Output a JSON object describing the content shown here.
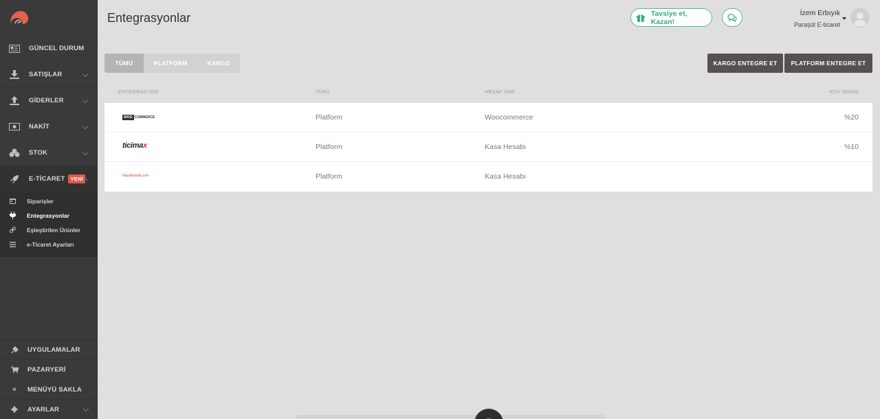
{
  "header": {
    "title": "Entegrasyonlar",
    "refer_label": "Tavsiye et, Kazan!",
    "user_name": "İzem Erbıyık",
    "company": "Paraşüt E-ticaret"
  },
  "sidebar": {
    "items": [
      {
        "label": "GÜNCEL DURUM",
        "icon": "newspaper-icon"
      },
      {
        "label": "SATIŞLAR",
        "icon": "download-icon"
      },
      {
        "label": "GİDERLER",
        "icon": "upload-icon"
      },
      {
        "label": "NAKİT",
        "icon": "cash-icon"
      },
      {
        "label": "STOK",
        "icon": "cubes-icon"
      },
      {
        "label": "E-TİCARET",
        "icon": "rocket-icon",
        "badge": "YENİ"
      }
    ],
    "sub_items": [
      {
        "label": "Siparişler",
        "icon": "calendar-icon"
      },
      {
        "label": "Entegrasyonlar",
        "icon": "plug-icon"
      },
      {
        "label": "Eşleştirilen Ürünler",
        "icon": "link-icon"
      },
      {
        "label": "e-Ticaret Ayarları",
        "icon": "list-icon"
      }
    ],
    "bottom_items": [
      {
        "label": "UYGULAMALAR",
        "icon": "plug-icon"
      },
      {
        "label": "PAZARYERİ",
        "icon": "cart-icon"
      },
      {
        "label": "MENÜYÜ SAKLA",
        "icon": "double-chevron-left-icon"
      },
      {
        "label": "AYARLAR",
        "icon": "gear-icon"
      }
    ]
  },
  "filters": {
    "tabs": [
      "TÜMÜ",
      "PLATFORM",
      "KARGO"
    ],
    "active": "TÜMÜ"
  },
  "actions": {
    "kargo_label": "KARGO ENTEGRE ET",
    "platform_label": "PLATFORM ENTEGRE ET"
  },
  "table": {
    "columns": [
      "ENTEGRASYON",
      "TÜRÜ",
      "HESAP İSMİ",
      "KDV ORANI"
    ],
    "rows": [
      {
        "logo_box": "WOO",
        "logo_text": "COMMERCE",
        "type": "Platform",
        "account": "Woocommerce",
        "vat": "%20"
      },
      {
        "logo_main": "ticima",
        "logo_accent": "x",
        "type": "Platform",
        "account": "Kasa Hesabı",
        "vat": "%10"
      },
      {
        "logo_text": "hepsiburada.com",
        "type": "Platform",
        "account": "Kasa Hesabı",
        "vat": ""
      }
    ]
  },
  "colors": {
    "sidebar_bg": "#3a3a3a",
    "accent_green": "#4cbc98",
    "badge_red": "#e25a4c",
    "dark_button": "#555150"
  }
}
